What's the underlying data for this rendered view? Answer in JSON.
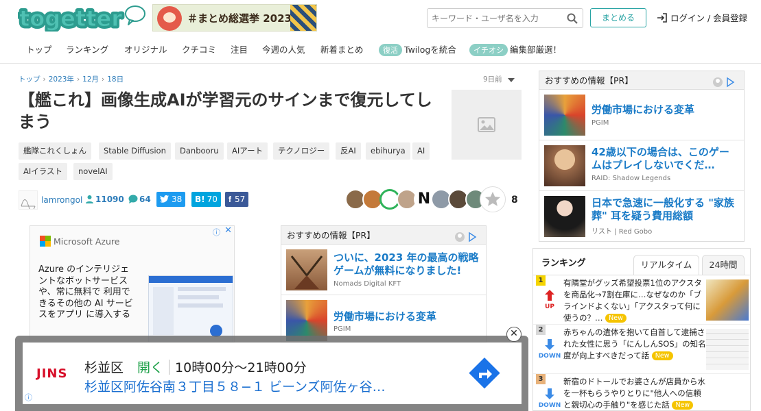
{
  "header": {
    "logo_text": "togetter",
    "banner_text": "＃まとめ総選挙 2023",
    "search_placeholder": "キーワード・ユーザ名を入力",
    "matome_button": "まとめる",
    "login_text": "ログイン / 会員登録"
  },
  "nav": {
    "items": [
      "トップ",
      "ランキング",
      "オリジナル",
      "クチコミ",
      "注目",
      "今週の人気",
      "新着まとめ"
    ],
    "badge1": "復活",
    "twilog": "Twilogを統合",
    "badge2": "イチオシ",
    "pick": "編集部厳選！"
  },
  "breadcrumb": [
    "トップ",
    "2023年",
    "12月",
    "18日"
  ],
  "time_ago": "9日前",
  "article": {
    "title": "【艦これ】画像生成AIが学習元のサインまで復元してしまう",
    "tags": [
      "艦隊これくしょん",
      "Stable Diffusion",
      "Danbooru",
      "AIアート",
      "テクノロジー",
      "反AI",
      "ebihurya",
      "AI",
      "AIイラスト",
      "novelAI"
    ],
    "author": "lamrongol",
    "followers": "11090",
    "comments": "64",
    "twitter_count": "38",
    "hatena_label": "B!",
    "hatena_count": "70",
    "facebook_count": "57",
    "favorites_count": "8",
    "face_letter": "N"
  },
  "azure_ad": {
    "brand": "Microsoft Azure",
    "text": "Azure のインテリジェントなボットサービスや、常に無料で 利用できるその他の AI サービスをアプリ に導入する",
    "info": "ⓘ",
    "close": "✕"
  },
  "recommend_mid": {
    "heading": "おすすめの情報【PR】",
    "items": [
      {
        "title": "ついに、2023 年の最高の戦略ゲームが無料になりました!",
        "source": "Nomads Digital KFT"
      },
      {
        "title": "労働市場における変革",
        "source": "PGIM"
      }
    ]
  },
  "recommend_right": {
    "heading": "おすすめの情報【PR】",
    "items": [
      {
        "title": "労働市場における変革",
        "source": "PGIM"
      },
      {
        "title": "42歳以下の場合は、このゲームはプレイしないでくだ…",
        "source": "RAID: Shadow Legends"
      },
      {
        "title": "日本で急速に一般化する \"家族葬\" 耳を疑う費用総額",
        "source": "リスト | Red Gobo"
      }
    ]
  },
  "ranking": {
    "title": "ランキング",
    "tab_realtime": "リアルタイム",
    "tab_24h": "24時間",
    "new_label": "New",
    "rows": [
      {
        "rank": "1",
        "move": "UP",
        "text": "有隣堂がグッズ希望投票1位のアクスタを商品化→7割在庫に…なぜなのか「ブラインドよくない」「アクスタって何に使うの？…"
      },
      {
        "rank": "2",
        "move": "DOWN",
        "text": "赤ちゃんの遺体を抱いて自首して逮捕された女性に思う「にんしんSOS」の知名度が向上すべきだって話"
      },
      {
        "rank": "3",
        "move": "DOWN",
        "text": "新宿のドトールでお婆さんが店員から水を一杯もらうやりとりに\"他人への信頼と親切心の手触り\"を感じた話"
      }
    ]
  },
  "bottom_ad": {
    "brand": "JINS",
    "place": "杉並区",
    "status": "開く",
    "hours": "10時00分〜21時00分",
    "address": "杉並区阿佐谷南３丁目５８−１ ビーンズ阿佐ヶ谷…",
    "info": "ⓘ",
    "close": "✕"
  },
  "colors": {
    "brand_teal": "#27a3a3",
    "link_blue": "#2b7bb9",
    "title_blue": "#1a7bc7",
    "up_red": "#d22",
    "down_blue": "#3b8be6"
  }
}
